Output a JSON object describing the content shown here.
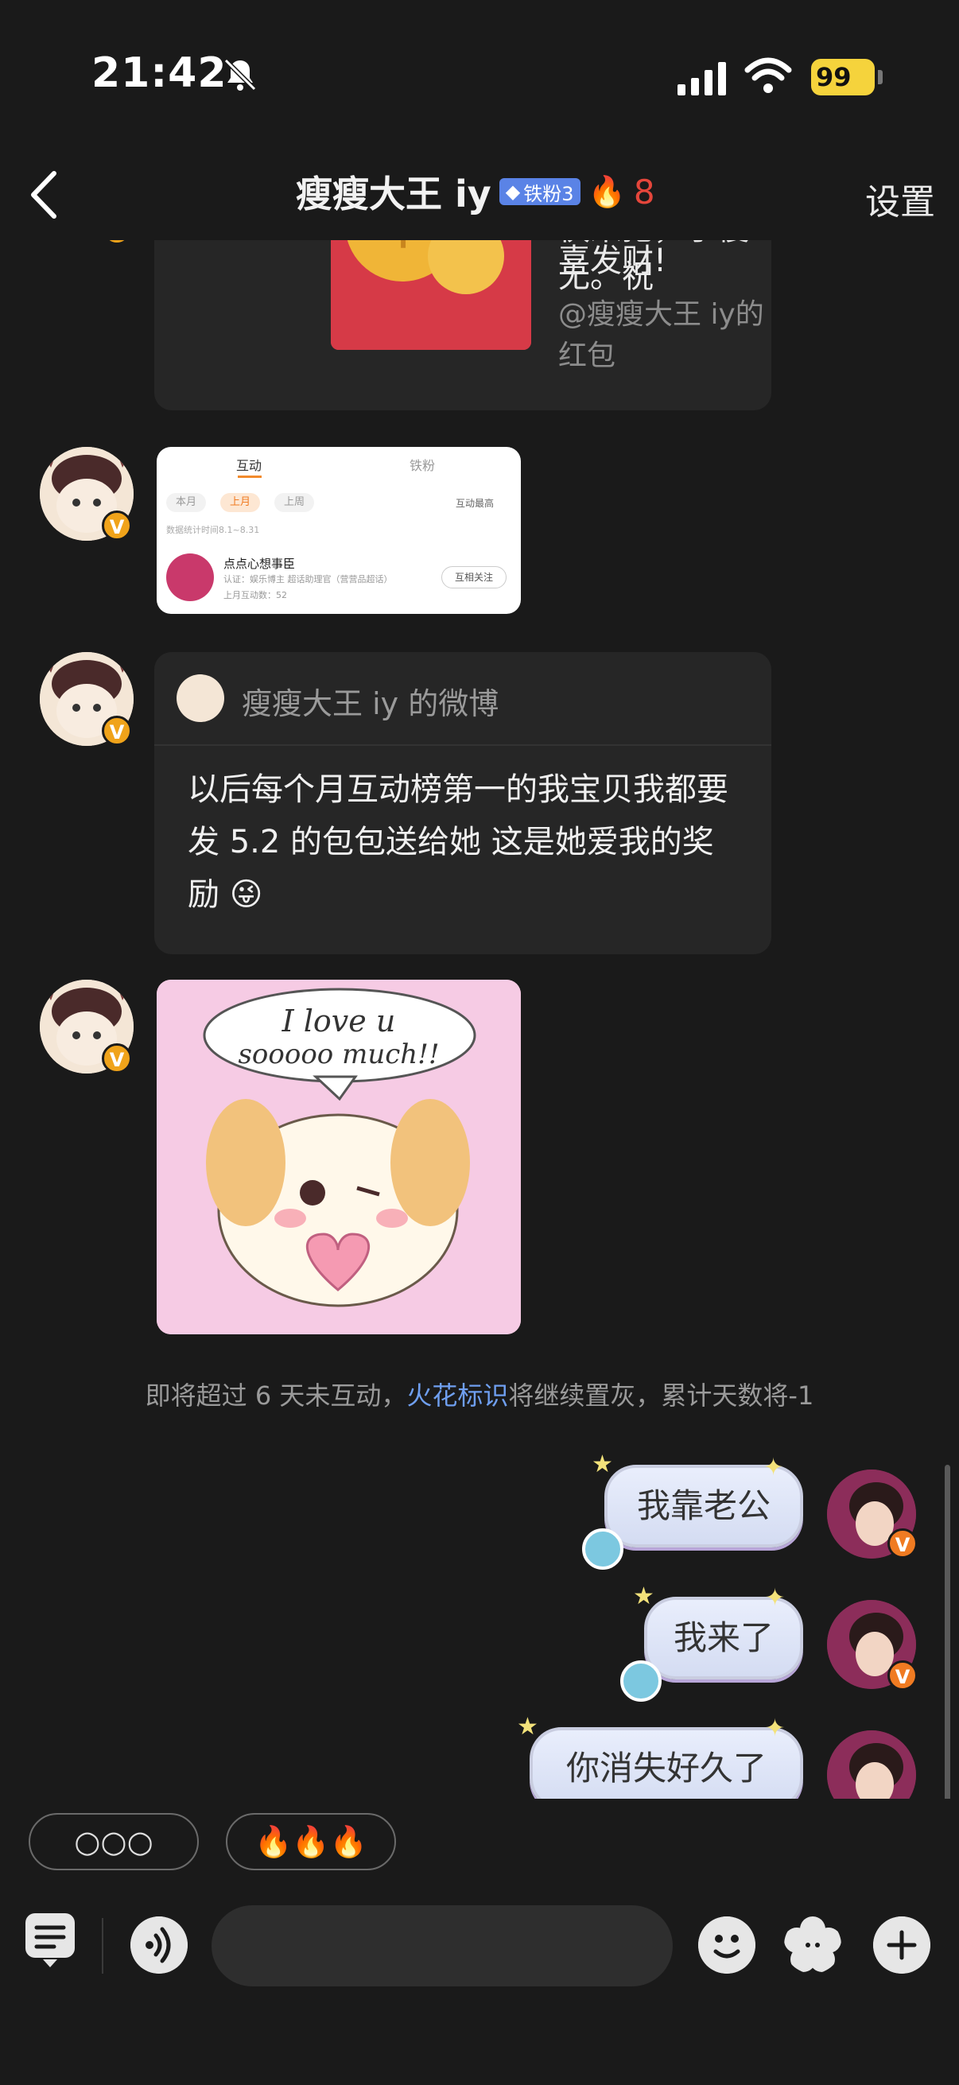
{
  "status": {
    "time": "21:42",
    "battery": "99"
  },
  "nav": {
    "title": "瘦瘦大王 iy",
    "fan_badge": "铁粉3",
    "flame_count": "8",
    "settings": "设置"
  },
  "messages": {
    "red_packet": {
      "text_line1": "快来抢，手慢无。祝",
      "text_line2": "喜发财!",
      "sub": "@瘦瘦大王 iy的红包"
    },
    "screenshot": {
      "tabs": [
        "互动",
        "铁粉"
      ],
      "filters": [
        "本月",
        "上月",
        "上周"
      ],
      "sort": "互动最高",
      "stat_note": "数据统计时间8.1~8.31",
      "user_name": "点点心想事臣",
      "user_desc": "认证：娱乐博主 超话助理官（营营品超话）",
      "user_count": "上月互动数：52",
      "follow_btn": "互相关注"
    },
    "weibo": {
      "title": "瘦瘦大王 iy 的微博",
      "body": "以后每个月互动榜第一的我宝贝我都要发 5.2 的包包送给她 这是她爱我的奖励 😜"
    },
    "sticker": {
      "line1": "I love u",
      "line2": "sooooo much!!"
    },
    "notice": {
      "before": "即将超过 6 天未互动，",
      "link": "火花标识",
      "after": "将继续置灰，累计天数将-1"
    },
    "outgoing": [
      "我靠老公",
      "我来了",
      "你消失好久了"
    ]
  },
  "quick_replies": [
    "○○○",
    "🔥🔥🔥"
  ],
  "input": {
    "placeholder": ""
  },
  "avatar_badge": "V",
  "colors": {
    "accent_blue": "#6f9ff0",
    "flame_red": "#e5463b",
    "badge_orange": "#f0a31a",
    "fan_badge_blue": "#5a83e6"
  }
}
